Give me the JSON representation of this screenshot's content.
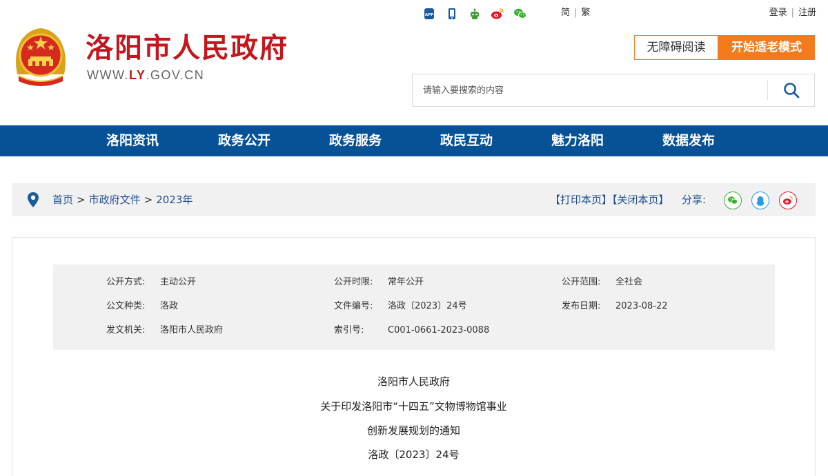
{
  "site": {
    "title": "洛阳市人民政府",
    "domain_prefix": "WWW.",
    "domain_highlight": "LY",
    "domain_suffix": ".GOV.CN"
  },
  "top_icons": [
    "app-icon",
    "mobile-icon",
    "robot-icon",
    "weibo-icon",
    "wechat-icon"
  ],
  "lang": {
    "simplified": "简",
    "traditional": "繁"
  },
  "auth": {
    "login": "登录",
    "register": "注册"
  },
  "accessibility": {
    "barrier_free": "无障碍阅读",
    "elder_mode": "开始适老模式"
  },
  "search": {
    "placeholder": "请输入要搜索的内容"
  },
  "nav": [
    "洛阳资讯",
    "政务公开",
    "政务服务",
    "政民互动",
    "魅力洛阳",
    "数据发布"
  ],
  "breadcrumb": {
    "home": "首页",
    "level1": "市政府文件",
    "level2": "2023年",
    "arrow": ">"
  },
  "tools": {
    "print": "【打印本页】",
    "close": "【关闭本页】",
    "share": "分享:"
  },
  "meta": {
    "method_label": "公开方式:",
    "method": "主动公开",
    "period_label": "公开时限:",
    "period": "常年公开",
    "scope_label": "公开范围:",
    "scope": "全社会",
    "type_label": "公文种类:",
    "type": "洛政",
    "doc_no_label": "文件编号:",
    "doc_no": "洛政〔2023〕24号",
    "date_label": "发布日期:",
    "date": "2023-08-22",
    "issuer_label": "发文机关:",
    "issuer": "洛阳市人民政府",
    "index_label": "索引号:",
    "index": "C001-0661-2023-0088"
  },
  "document": {
    "issuer": "洛阳市人民政府",
    "title_line1": "关于印发洛阳市“十四五”文物博物馆事业",
    "title_line2": "创新发展规划的通知",
    "number": "洛政〔2023〕24号"
  },
  "colors": {
    "brand_red": "#c4161c",
    "nav_blue": "#075297",
    "accent_orange": "#f37b1d",
    "link_blue": "#1f4f8f"
  }
}
